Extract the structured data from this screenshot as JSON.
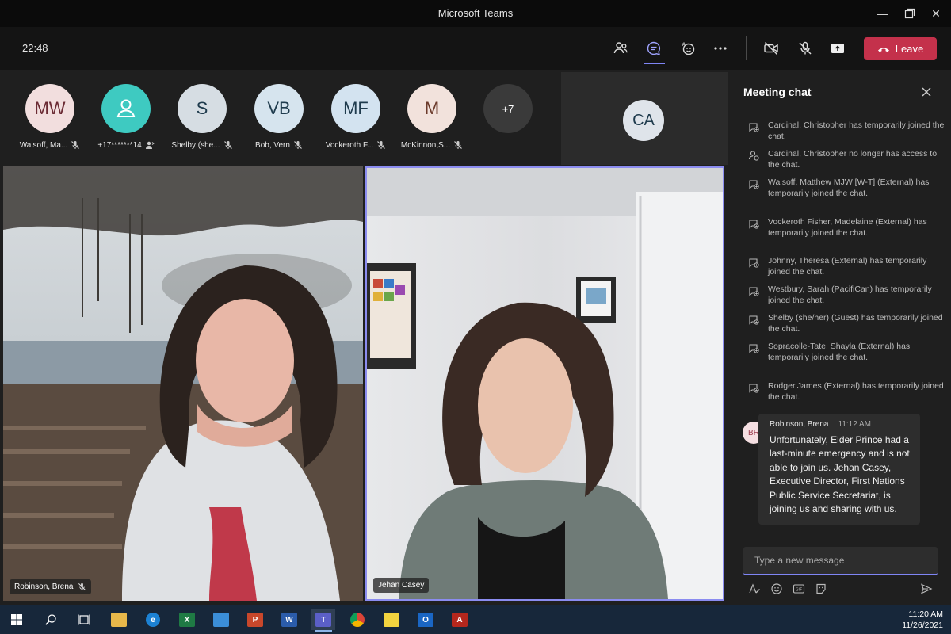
{
  "window": {
    "title": "Microsoft Teams"
  },
  "toolbar": {
    "clock": "22:48",
    "leave_label": "Leave"
  },
  "participants": [
    {
      "initials": "MW",
      "name": "Walsoff, Ma...",
      "color": "#f2dede",
      "text_color": "#6b2b34"
    },
    {
      "initials": "",
      "name": "+17*******14",
      "color": "#3ecac1",
      "icon": "person-icon"
    },
    {
      "initials": "S",
      "name": "Shelby (she...",
      "color": "#d6dde3",
      "text_color": "#1f3b4d"
    },
    {
      "initials": "VB",
      "name": "Bob, Vern",
      "color": "#d6e4ee",
      "text_color": "#1f3b4d"
    },
    {
      "initials": "MF",
      "name": "Vockeroth F...",
      "color": "#d3e3f0",
      "text_color": "#1f3b4d"
    },
    {
      "initials": "M",
      "name": "McKinnon,S...",
      "color": "#f2e2dc",
      "text_color": "#6b3a2b"
    },
    {
      "initials": "+7",
      "name": "",
      "color": "#3a3a3a",
      "text_color": "#ffffff"
    }
  ],
  "ca_tile": {
    "initials": "CA"
  },
  "videos": [
    {
      "name": "Robinson, Brena"
    },
    {
      "name": "Jehan Casey"
    }
  ],
  "chat": {
    "title": "Meeting chat",
    "events": [
      {
        "text": "Cardinal, Christopher has temporarily joined the chat.",
        "icon": "chat-add-icon"
      },
      {
        "text": "Cardinal, Christopher no longer has access to the chat.",
        "icon": "people-remove-icon"
      },
      {
        "text": "Walsoff, Matthew MJW [W-T] (External) has temporarily joined the chat.",
        "icon": "chat-add-icon"
      },
      {
        "text": "Vockeroth Fisher, Madelaine (External) has temporarily joined the chat.",
        "icon": "chat-add-icon"
      },
      {
        "text": "Johnny, Theresa (External) has temporarily joined the chat.",
        "icon": "chat-add-icon"
      },
      {
        "text": "Westbury, Sarah (PacifiCan) has temporarily joined the chat.",
        "icon": "chat-add-icon"
      },
      {
        "text": "Shelby (she/her) (Guest) has temporarily joined the chat.",
        "icon": "chat-add-icon"
      },
      {
        "text": "Sopracolle-Tate, Shayla (External) has temporarily joined the chat.",
        "icon": "chat-add-icon"
      },
      {
        "text": "Rodger.James (External) has temporarily joined the chat.",
        "icon": "chat-add-icon"
      }
    ],
    "message": {
      "avatar": "BR",
      "author": "Robinson, Brena",
      "time": "11:12 AM",
      "text": "Unfortunately, Elder Prince had a last-minute emergency and is not able to join us. Jehan Casey, Executive Director, First Nations Public Service Secretariat, is joining us and sharing with us."
    },
    "compose_placeholder": "Type a new message"
  },
  "taskbar": {
    "time": "11:20 AM",
    "date": "11/26/2021"
  }
}
